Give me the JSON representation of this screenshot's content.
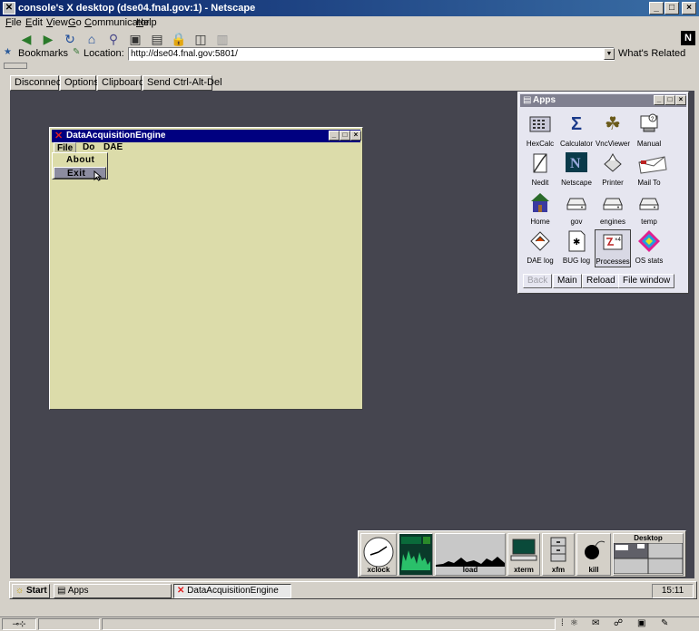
{
  "window": {
    "title": "console's X desktop (dse04.fnal.gov:1) - Netscape",
    "controls": {
      "minimize": "_",
      "maximize": "□",
      "close": "×"
    }
  },
  "menubar": [
    {
      "label": "File",
      "key": "F",
      "rest": "ile"
    },
    {
      "label": "Edit",
      "key": "E",
      "rest": "dit"
    },
    {
      "label": "View",
      "key": "V",
      "rest": "iew"
    },
    {
      "label": "Go",
      "key": "G",
      "rest": "o"
    },
    {
      "label": "Communicator",
      "key": "C",
      "rest": "ommunicator"
    },
    {
      "label": "Help",
      "key": "H",
      "rest": "elp"
    }
  ],
  "toolbar": {
    "icons": [
      "back-icon",
      "forward-icon",
      "reload-icon",
      "home-icon",
      "search-icon",
      "netscape-guide-icon",
      "print-icon",
      "security-icon",
      "shop-icon",
      "stop-icon"
    ],
    "logo": "N"
  },
  "locationbar": {
    "bookmarks_label": "Bookmarks",
    "location_label": "Location:",
    "url": "http://dse04.fnal.gov:5801/",
    "whats_related": "What's Related"
  },
  "vnc_toolbar": {
    "disconnect": "Disconnect",
    "options": "Options",
    "clipboard": "Clipboard",
    "send_cad": "Send Ctrl-Alt-Del"
  },
  "dae_window": {
    "title": "DataAcquisitionEngine",
    "menus": [
      "File",
      "Do",
      "DAE"
    ],
    "file_menu_items": [
      "About",
      "Exit"
    ],
    "selected_item": "Exit"
  },
  "apps_window": {
    "title": "Apps",
    "apps": [
      {
        "label": "HexCalc",
        "icon": "calculator-keypad-icon"
      },
      {
        "label": "Calculator",
        "icon": "sigma-icon"
      },
      {
        "label": "VncViewer",
        "icon": "vncviewer-icon"
      },
      {
        "label": "Manual",
        "icon": "manual-icon"
      },
      {
        "label": "Nedit",
        "icon": "nedit-icon"
      },
      {
        "label": "Netscape",
        "icon": "netscape-icon"
      },
      {
        "label": "Printer",
        "icon": "printer-icon"
      },
      {
        "label": "Mail To",
        "icon": "mail-icon"
      },
      {
        "label": "Home",
        "icon": "home-icon"
      },
      {
        "label": "gov",
        "icon": "drive-icon"
      },
      {
        "label": "engines",
        "icon": "drive-icon"
      },
      {
        "label": "temp",
        "icon": "drive-icon"
      },
      {
        "label": "DAE log",
        "icon": "log-icon"
      },
      {
        "label": "BUG log",
        "icon": "bug-icon"
      },
      {
        "label": "Processes",
        "icon": "processes-icon"
      },
      {
        "label": "OS stats",
        "icon": "os-stats-icon"
      }
    ],
    "buttons": {
      "back": "Back",
      "main": "Main",
      "reload": "Reload",
      "file_window": "File window"
    }
  },
  "dock": {
    "xclock": "xclock",
    "load": "load",
    "xterm": "xterm",
    "xfm": "xfm",
    "kill": "kill",
    "desktop": "Desktop"
  },
  "taskbar": {
    "start": "Start",
    "apps": "Apps",
    "dae": "DataAcquisitionEngine",
    "clock": "15:11"
  }
}
